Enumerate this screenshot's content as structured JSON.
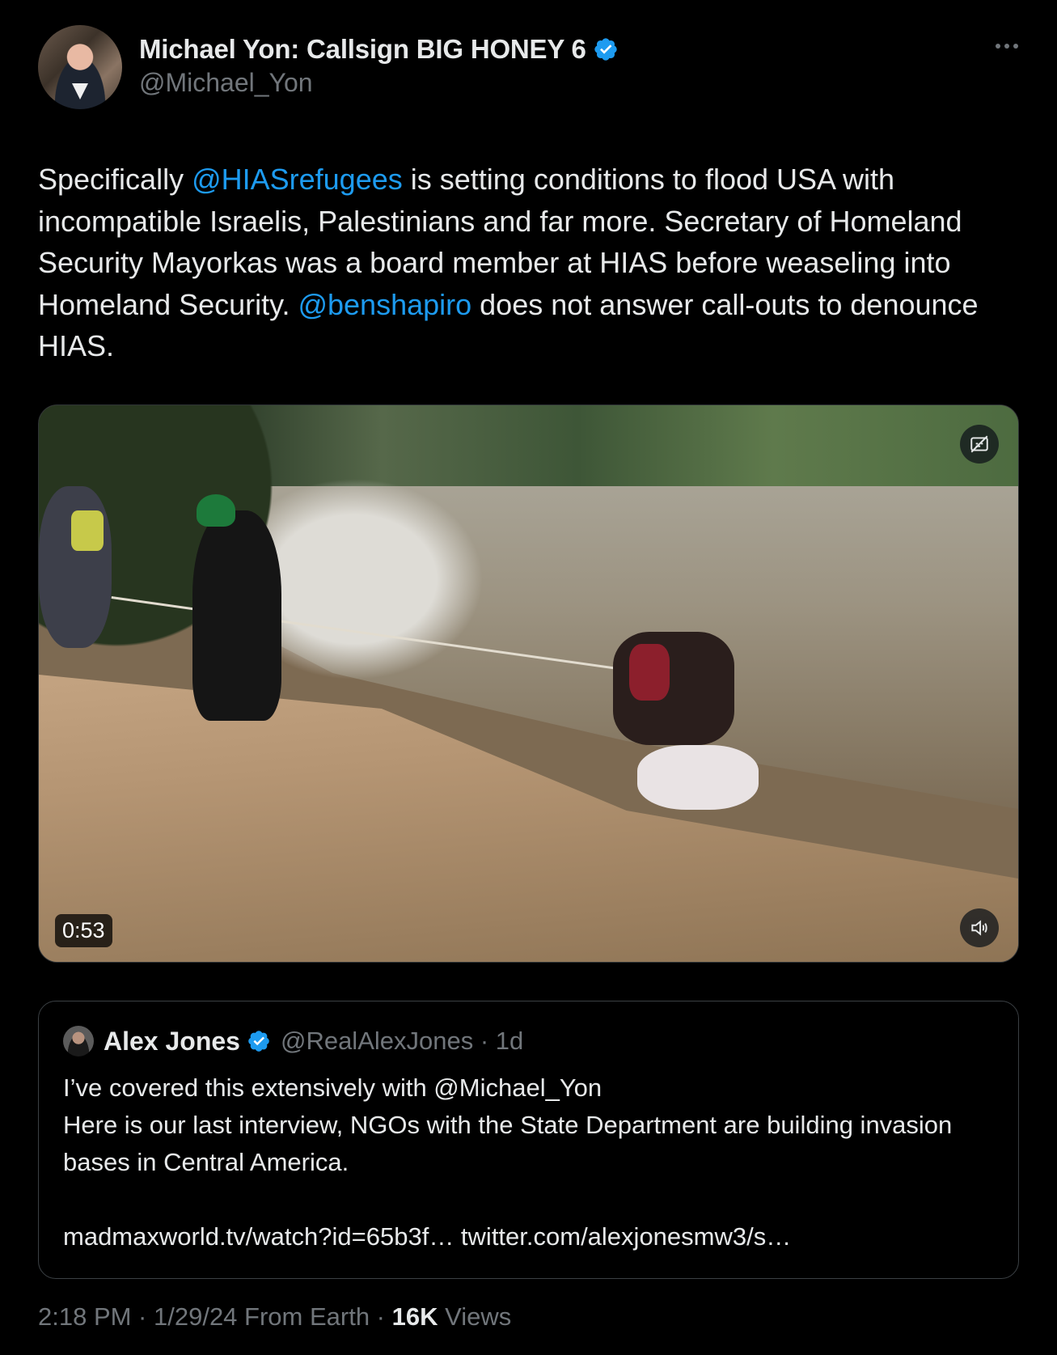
{
  "author": {
    "display_name": "Michael Yon: Callsign BIG HONEY 6",
    "handle": "@Michael_Yon",
    "verified_icon": "verified-badge-icon"
  },
  "tweet": {
    "text_parts": {
      "p1": "Specifically ",
      "mention1": "@HIASrefugees",
      "p2": " is setting conditions to flood USA with incompatible Israelis, Palestinians and far more.  Secretary of Homeland Security Mayorkas was a board member at HIAS before weaseling into Homeland Security.  ",
      "mention2": "@benshapiro",
      "p3": " does not answer call-outs to denounce HIAS."
    }
  },
  "video": {
    "duration": "0:53",
    "caption_icon": "captions-off-icon",
    "volume_icon": "volume-icon"
  },
  "quote": {
    "display_name": "Alex Jones",
    "handle_time": "@RealAlexJones · 1d",
    "text": "I’ve covered this extensively with @Michael_Yon\nHere is our last interview, NGOs with the State Department are building invasion bases in Central America.\n\nmadmaxworld.tv/watch?id=65b3f… twitter.com/alexjonesmw3/s…"
  },
  "footer": {
    "meta": "2:18 PM · 1/29/24 From Earth · ",
    "views_count": "16K",
    "views_label": " Views"
  },
  "colors": {
    "background": "#000000",
    "text": "#e7e9ea",
    "secondary": "#71767b",
    "link": "#1d9bf0"
  }
}
